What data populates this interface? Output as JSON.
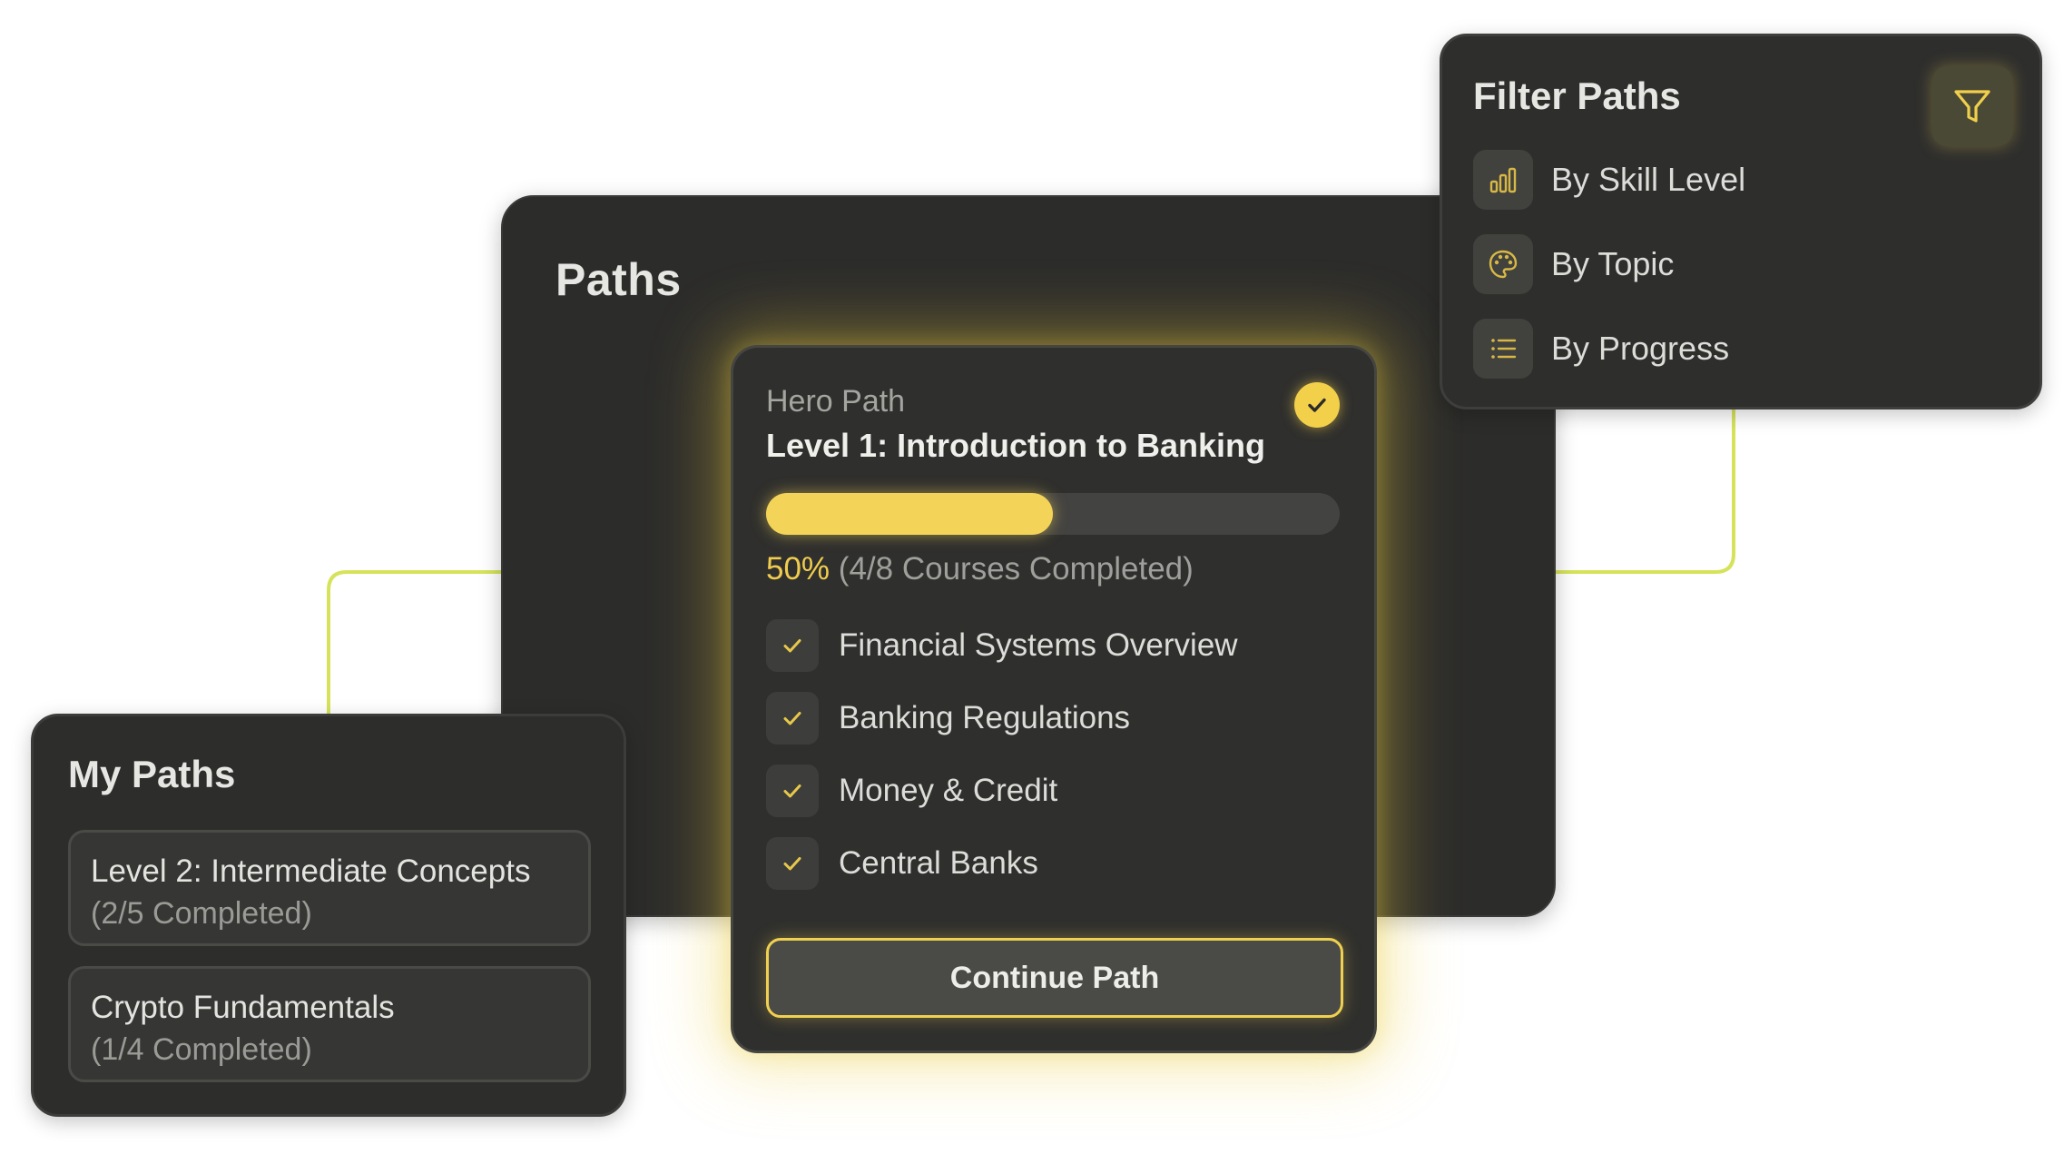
{
  "colors": {
    "accent": "#f3d04a",
    "panel_bg": "#2c2c2b",
    "connector": "#d6e35a"
  },
  "main": {
    "title": "Paths"
  },
  "hero": {
    "eyebrow": "Hero Path",
    "title": "Level 1: Introduction to Banking",
    "status_icon": "check-circle-icon",
    "progress_fraction": 0.5,
    "progress_percent": "50%",
    "progress_detail": "(4/8 Courses Completed)",
    "courses": [
      {
        "label": "Financial Systems Overview",
        "completed": true
      },
      {
        "label": "Banking Regulations",
        "completed": true
      },
      {
        "label": "Money & Credit",
        "completed": true
      },
      {
        "label": "Central Banks",
        "completed": true
      }
    ],
    "continue_label": "Continue Path"
  },
  "filter": {
    "title": "Filter Paths",
    "button_icon": "funnel-icon",
    "items": [
      {
        "label": "By Skill Level",
        "icon": "bar-chart-icon"
      },
      {
        "label": "By Topic",
        "icon": "palette-icon"
      },
      {
        "label": "By Progress",
        "icon": "list-icon"
      }
    ]
  },
  "my_paths": {
    "title": "My Paths",
    "items": [
      {
        "name": "Level 2: Intermediate Concepts",
        "status": "(2/5 Completed)"
      },
      {
        "name": "Crypto Fundamentals",
        "status": "(1/4 Completed)"
      }
    ]
  }
}
